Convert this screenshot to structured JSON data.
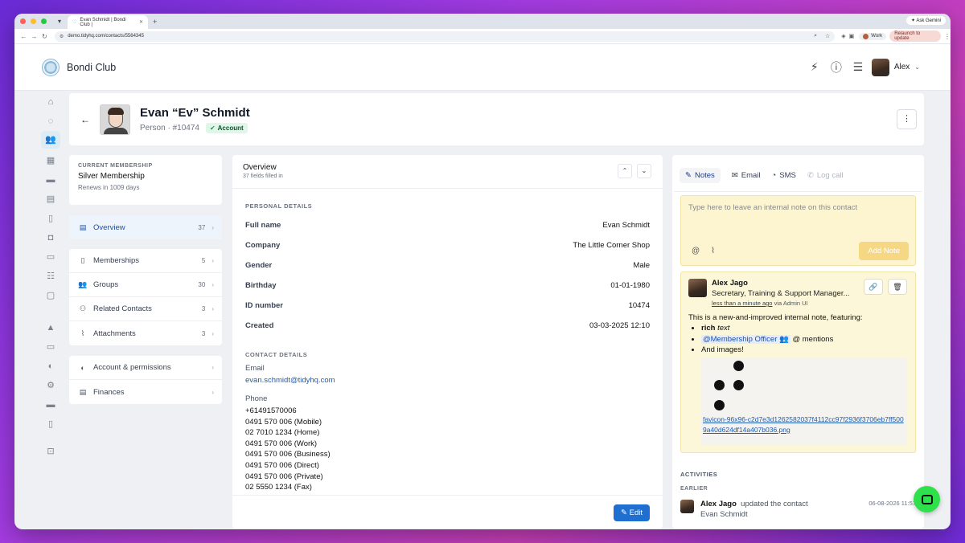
{
  "browser": {
    "tab_title": "Evan Schmidt | Bondi Club |",
    "gemini_label": "Ask Gemini",
    "url": "demo.tidyhq.com/contacts/5564345",
    "profile_label": "Work",
    "relaunch_label": "Relaunch to update"
  },
  "app": {
    "name": "Bondi Club",
    "user_name": "Alex"
  },
  "person": {
    "name": "Evan “Ev” Schmidt",
    "subtitle": "Person · #10474",
    "badge": "Account"
  },
  "membership": {
    "caption": "CURRENT MEMBERSHIP",
    "name": "Silver Membership",
    "renews": "Renews in 1009 days"
  },
  "nav": {
    "overview": {
      "label": "Overview",
      "count": "37"
    },
    "memberships": {
      "label": "Memberships",
      "count": "5"
    },
    "groups": {
      "label": "Groups",
      "count": "30"
    },
    "related": {
      "label": "Related Contacts",
      "count": "3"
    },
    "attachments": {
      "label": "Attachments",
      "count": "3"
    },
    "account": {
      "label": "Account & permissions"
    },
    "finances": {
      "label": "Finances"
    }
  },
  "overview": {
    "title": "Overview",
    "subtitle": "37 fields filled in",
    "personal_caption": "PERSONAL DETAILS",
    "fields": [
      {
        "k": "Full name",
        "v": "Evan Schmidt"
      },
      {
        "k": "Company",
        "v": "The Little Corner Shop"
      },
      {
        "k": "Gender",
        "v": "Male"
      },
      {
        "k": "Birthday",
        "v": "01-01-1980"
      },
      {
        "k": "ID number",
        "v": "10474"
      },
      {
        "k": "Created",
        "v": "03-03-2025 12:10"
      }
    ],
    "contact_caption": "CONTACT DETAILS",
    "email_label": "Email",
    "email": "evan.schmidt@tidyhq.com",
    "phone_label": "Phone",
    "phones": [
      "+61491570006",
      "0491 570 006 (Mobile)",
      "02 7010 1234 (Home)",
      "0491 570 006 (Work)",
      "0491 570 006 (Business)",
      "0491 570 006 (Direct)",
      "0491 570 006 (Private)",
      "02 5550 1234 (Fax)"
    ],
    "edit_label": "Edit"
  },
  "notes": {
    "tabs": {
      "notes": "Notes",
      "email": "Email",
      "sms": "SMS",
      "log": "Log call"
    },
    "placeholder": "Type here to leave an internal note on this contact",
    "add_label": "Add Note",
    "note": {
      "author": "Alex Jago",
      "role": "Secretary, Training & Support Manager...",
      "time": "less than a minute ago",
      "via": "via Admin UI",
      "intro": "This is a new-and-improved internal note, featuring:",
      "rich_bold": "rich",
      "rich_italic": "text",
      "mention": "@Membership Officer",
      "mention_suffix": "@ mentions",
      "images": "And images!",
      "filename": "favicon-96x96-c2d7e3d1262582037f4112cc97f2936f3706eb7ff5009a40d624df14a407b036.png"
    }
  },
  "activities": {
    "caption": "ACTIVITIES",
    "earlier": "EARLIER",
    "actor": "Alex Jago",
    "action": "updated the contact",
    "date": "06-08-2026 11:57",
    "subject": "Evan Schmidt"
  },
  "colors": {
    "accent": "#1f6fd1",
    "note_bg": "#fdf7d9",
    "chat_button": "#2ee04a"
  }
}
